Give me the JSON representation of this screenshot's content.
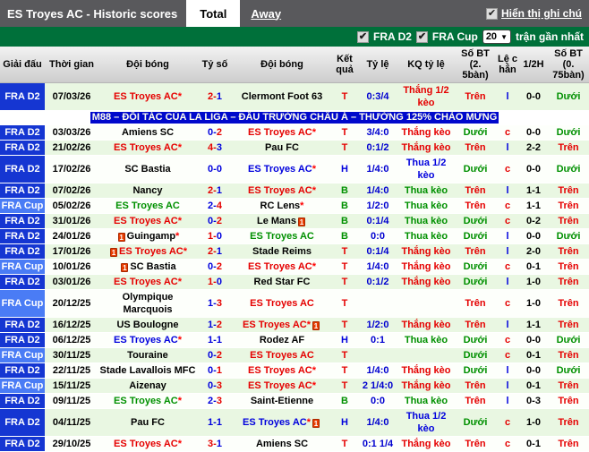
{
  "header": {
    "title": "ES Troyes AC - Historic scores",
    "tabs": [
      {
        "label": "Total",
        "active": true
      },
      {
        "label": "Away",
        "active": false
      }
    ],
    "note_checkbox": {
      "checked": true,
      "label": "Hiển thị ghi chú"
    }
  },
  "filter_bar": {
    "league_filters": [
      {
        "label": "FRA D2",
        "checked": true
      },
      {
        "label": "FRA Cup",
        "checked": true
      }
    ],
    "match_count": "20",
    "suffix_label": "trận gần nhất"
  },
  "ad_banner": "M88 – ĐỐI TÁC CỦA LA LIGA – ĐẤU TRƯỜNG CHÂU Á – THƯỞNG 125% CHÀO MỪNG",
  "colors": {
    "win_red": "#e50000",
    "loss_green": "#009000",
    "draw_blue": "#0000dd",
    "odds_blue": "#0000d0",
    "over_red": "#ff2020",
    "under_green": "#009000",
    "league_d2_bg": "#1536d2",
    "league_cup_bg": "#4a7cf5",
    "filter_bar_bg": "#00703a",
    "ad_bg": "#0008cc",
    "row_green_bg": "#e9f7e2",
    "row_white_bg": "#fdfffb"
  },
  "table": {
    "columns": [
      "Giải đấu",
      "Thời gian",
      "Đội bóng",
      "Tỷ số",
      "Đội bóng",
      "Kết quả",
      "Tỷ lệ",
      "KQ tỷ lệ",
      "Số BT (2. 5bàn)",
      "Lệ c hẳn",
      "1/2H",
      "Số BT (0. 75bàn)"
    ],
    "legend": {
      "T": "red",
      "H": "blue",
      "B": "green",
      "Trên": "red",
      "Dưới": "green",
      "l": "blue",
      "c": "red"
    },
    "rows": [
      {
        "league": "FRA D2",
        "date": "07/03/26",
        "home": {
          "name": "ES Troyes AC",
          "star": true,
          "card": false,
          "color": "red"
        },
        "score": "2-1",
        "away": {
          "name": "Clermont Foot 63",
          "star": false,
          "card": false,
          "color": "black"
        },
        "result": "T",
        "odds": "0:3/4",
        "kq": {
          "text": "Thắng 1/2 kèo",
          "color": "red"
        },
        "ou25": "Trên",
        "oe": "l",
        "half": "0-0",
        "ou075": "Dưới"
      },
      {
        "league": "FRA D2",
        "date": "03/03/26",
        "home": {
          "name": "Amiens SC",
          "star": false,
          "card": false,
          "color": "black"
        },
        "score": "0-2",
        "away": {
          "name": "ES Troyes AC",
          "star": true,
          "card": false,
          "color": "red"
        },
        "result": "T",
        "odds": "3/4:0",
        "kq": {
          "text": "Thắng kèo",
          "color": "red"
        },
        "ou25": "Dưới",
        "oe": "c",
        "half": "0-0",
        "ou075": "Dưới"
      },
      {
        "league": "FRA D2",
        "date": "21/02/26",
        "home": {
          "name": "ES Troyes AC",
          "star": true,
          "card": false,
          "color": "red"
        },
        "score": "4-3",
        "away": {
          "name": "Pau FC",
          "star": false,
          "card": false,
          "color": "black"
        },
        "result": "T",
        "odds": "0:1/2",
        "kq": {
          "text": "Thắng kèo",
          "color": "red"
        },
        "ou25": "Trên",
        "oe": "l",
        "half": "2-2",
        "ou075": "Trên"
      },
      {
        "league": "FRA D2",
        "date": "17/02/26",
        "home": {
          "name": "SC Bastia",
          "star": false,
          "card": false,
          "color": "black"
        },
        "score": "0-0",
        "away": {
          "name": "ES Troyes AC",
          "star": true,
          "card": false,
          "color": "blue"
        },
        "result": "H",
        "odds": "1/4:0",
        "kq": {
          "text": "Thua 1/2 kèo",
          "color": "blue"
        },
        "ou25": "Dưới",
        "oe": "c",
        "half": "0-0",
        "ou075": "Dưới"
      },
      {
        "league": "FRA D2",
        "date": "07/02/26",
        "home": {
          "name": "Nancy",
          "star": false,
          "card": false,
          "color": "black"
        },
        "score": "2-1",
        "away": {
          "name": "ES Troyes AC",
          "star": true,
          "card": false,
          "color": "red"
        },
        "result": "B",
        "odds": "1/4:0",
        "kq": {
          "text": "Thua kèo",
          "color": "green"
        },
        "ou25": "Trên",
        "oe": "l",
        "half": "1-1",
        "ou075": "Trên"
      },
      {
        "league": "FRA Cup",
        "date": "05/02/26",
        "home": {
          "name": "ES Troyes AC",
          "star": false,
          "card": false,
          "color": "green"
        },
        "score": "2-4",
        "away": {
          "name": "RC Lens",
          "star": true,
          "card": false,
          "color": "black"
        },
        "result": "B",
        "odds": "1/2:0",
        "kq": {
          "text": "Thua kèo",
          "color": "green"
        },
        "ou25": "Trên",
        "oe": "c",
        "half": "1-1",
        "ou075": "Trên"
      },
      {
        "league": "FRA D2",
        "date": "31/01/26",
        "home": {
          "name": "ES Troyes AC",
          "star": true,
          "card": false,
          "color": "red"
        },
        "score": "0-2",
        "away": {
          "name": "Le Mans",
          "star": false,
          "card": true,
          "color": "black"
        },
        "result": "B",
        "odds": "0:1/4",
        "kq": {
          "text": "Thua kèo",
          "color": "green"
        },
        "ou25": "Dưới",
        "oe": "c",
        "half": "0-2",
        "ou075": "Trên"
      },
      {
        "league": "FRA D2",
        "date": "24/01/26",
        "home": {
          "name": "Guingamp",
          "star": true,
          "card": true,
          "color": "black"
        },
        "score": "1-0",
        "away": {
          "name": "ES Troyes AC",
          "star": false,
          "card": false,
          "color": "green"
        },
        "result": "B",
        "odds": "0:0",
        "kq": {
          "text": "Thua kèo",
          "color": "green"
        },
        "ou25": "Dưới",
        "oe": "l",
        "half": "0-0",
        "ou075": "Dưới"
      },
      {
        "league": "FRA D2",
        "date": "17/01/26",
        "home": {
          "name": "ES Troyes AC",
          "star": true,
          "card": true,
          "color": "red"
        },
        "score": "2-1",
        "away": {
          "name": "Stade Reims",
          "star": false,
          "card": false,
          "color": "black"
        },
        "result": "T",
        "odds": "0:1/4",
        "kq": {
          "text": "Thắng kèo",
          "color": "red"
        },
        "ou25": "Trên",
        "oe": "l",
        "half": "2-0",
        "ou075": "Trên"
      },
      {
        "league": "FRA Cup",
        "date": "10/01/26",
        "home": {
          "name": "SC Bastia",
          "star": false,
          "card": true,
          "color": "black"
        },
        "score": "0-2",
        "away": {
          "name": "ES Troyes AC",
          "star": true,
          "card": false,
          "color": "red"
        },
        "result": "T",
        "odds": "1/4:0",
        "kq": {
          "text": "Thắng kèo",
          "color": "red"
        },
        "ou25": "Dưới",
        "oe": "c",
        "half": "0-1",
        "ou075": "Trên"
      },
      {
        "league": "FRA D2",
        "date": "03/01/26",
        "home": {
          "name": "ES Troyes AC",
          "star": true,
          "card": false,
          "color": "red"
        },
        "score": "1-0",
        "away": {
          "name": "Red Star FC",
          "star": false,
          "card": false,
          "color": "black"
        },
        "result": "T",
        "odds": "0:1/2",
        "kq": {
          "text": "Thắng kèo",
          "color": "red"
        },
        "ou25": "Dưới",
        "oe": "l",
        "half": "1-0",
        "ou075": "Trên"
      },
      {
        "league": "FRA Cup",
        "date": "20/12/25",
        "home": {
          "name": "Olympique Marcquois",
          "star": false,
          "card": false,
          "color": "black"
        },
        "score": "1-3",
        "away": {
          "name": "ES Troyes AC",
          "star": false,
          "card": false,
          "color": "red"
        },
        "result": "T",
        "odds": "",
        "kq": {
          "text": "",
          "color": "red"
        },
        "ou25": "Trên",
        "oe": "c",
        "half": "1-0",
        "ou075": "Trên"
      },
      {
        "league": "FRA D2",
        "date": "16/12/25",
        "home": {
          "name": "US Boulogne",
          "star": false,
          "card": false,
          "color": "black"
        },
        "score": "1-2",
        "away": {
          "name": "ES Troyes AC",
          "star": true,
          "card": true,
          "color": "red"
        },
        "result": "T",
        "odds": "1/2:0",
        "kq": {
          "text": "Thắng kèo",
          "color": "red"
        },
        "ou25": "Trên",
        "oe": "l",
        "half": "1-1",
        "ou075": "Trên"
      },
      {
        "league": "FRA D2",
        "date": "06/12/25",
        "home": {
          "name": "ES Troyes AC",
          "star": true,
          "card": false,
          "color": "blue"
        },
        "score": "1-1",
        "away": {
          "name": "Rodez AF",
          "star": false,
          "card": false,
          "color": "black"
        },
        "result": "H",
        "odds": "0:1",
        "kq": {
          "text": "Thua kèo",
          "color": "green"
        },
        "ou25": "Dưới",
        "oe": "c",
        "half": "0-0",
        "ou075": "Dưới"
      },
      {
        "league": "FRA Cup",
        "date": "30/11/25",
        "home": {
          "name": "Touraine",
          "star": false,
          "card": false,
          "color": "black"
        },
        "score": "0-2",
        "away": {
          "name": "ES Troyes AC",
          "star": false,
          "card": false,
          "color": "red"
        },
        "result": "T",
        "odds": "",
        "kq": {
          "text": "",
          "color": "red"
        },
        "ou25": "Dưới",
        "oe": "c",
        "half": "0-1",
        "ou075": "Trên"
      },
      {
        "league": "FRA D2",
        "date": "22/11/25",
        "home": {
          "name": "Stade Lavallois MFC",
          "star": false,
          "card": false,
          "color": "black"
        },
        "score": "0-1",
        "away": {
          "name": "ES Troyes AC",
          "star": true,
          "card": false,
          "color": "red"
        },
        "result": "T",
        "odds": "1/4:0",
        "kq": {
          "text": "Thắng kèo",
          "color": "red"
        },
        "ou25": "Dưới",
        "oe": "l",
        "half": "0-0",
        "ou075": "Dưới"
      },
      {
        "league": "FRA Cup",
        "date": "15/11/25",
        "home": {
          "name": "Aizenay",
          "star": false,
          "card": false,
          "color": "black"
        },
        "score": "0-3",
        "away": {
          "name": "ES Troyes AC",
          "star": true,
          "card": false,
          "color": "red"
        },
        "result": "T",
        "odds": "2 1/4:0",
        "kq": {
          "text": "Thắng kèo",
          "color": "red"
        },
        "ou25": "Trên",
        "oe": "l",
        "half": "0-1",
        "ou075": "Trên"
      },
      {
        "league": "FRA D2",
        "date": "09/11/25",
        "home": {
          "name": "ES Troyes AC",
          "star": true,
          "card": false,
          "color": "green"
        },
        "score": "2-3",
        "away": {
          "name": "Saint-Etienne",
          "star": false,
          "card": false,
          "color": "black"
        },
        "result": "B",
        "odds": "0:0",
        "kq": {
          "text": "Thua kèo",
          "color": "green"
        },
        "ou25": "Trên",
        "oe": "l",
        "half": "0-3",
        "ou075": "Trên"
      },
      {
        "league": "FRA D2",
        "date": "04/11/25",
        "home": {
          "name": "Pau FC",
          "star": false,
          "card": false,
          "color": "black"
        },
        "score": "1-1",
        "away": {
          "name": "ES Troyes AC",
          "star": true,
          "card": true,
          "color": "blue"
        },
        "result": "H",
        "odds": "1/4:0",
        "kq": {
          "text": "Thua 1/2 kèo",
          "color": "blue"
        },
        "ou25": "Dưới",
        "oe": "c",
        "half": "1-0",
        "ou075": "Trên"
      },
      {
        "league": "FRA D2",
        "date": "29/10/25",
        "home": {
          "name": "ES Troyes AC",
          "star": true,
          "card": false,
          "color": "red"
        },
        "score": "3-1",
        "away": {
          "name": "Amiens SC",
          "star": false,
          "card": false,
          "color": "black"
        },
        "result": "T",
        "odds": "0:1 1/4",
        "kq": {
          "text": "Thắng kèo",
          "color": "red"
        },
        "ou25": "Trên",
        "oe": "c",
        "half": "0-1",
        "ou075": "Trên"
      }
    ]
  }
}
